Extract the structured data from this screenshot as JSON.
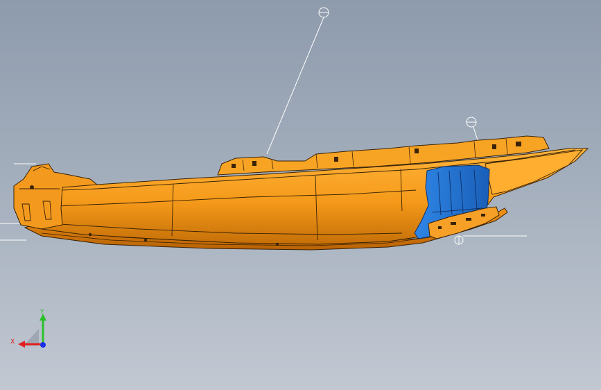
{
  "viewport": {
    "background_top": "#8e9bad",
    "background_bottom": "#c2c8d2"
  },
  "model": {
    "body_color": "#f59a1a",
    "body_highlight": "#ffb43a",
    "body_shadow": "#c56f08",
    "edge_color": "#3a2205",
    "bracket_color": "#2f86e6",
    "bracket_shadow": "#1a5fb8"
  },
  "triad": {
    "x_label": "X",
    "y_label": "Y",
    "x_color": "#e02020",
    "y_color": "#2ac02a",
    "z_color": "#1830e8"
  }
}
